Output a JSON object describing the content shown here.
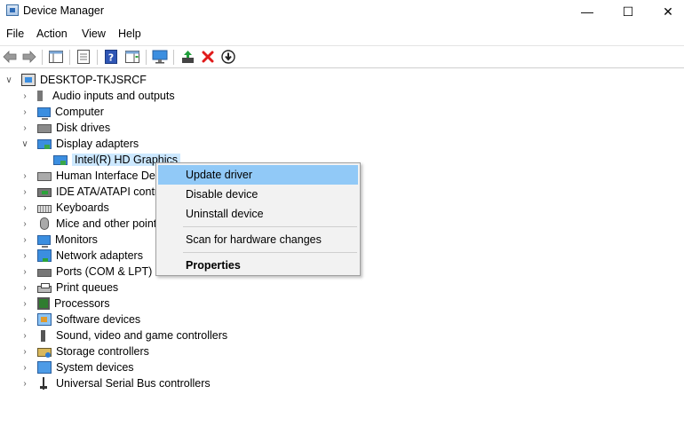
{
  "window": {
    "title": "Device Manager",
    "minimize": "—",
    "maximize": "☐",
    "close": "✕"
  },
  "menu": [
    "File",
    "Action",
    "View",
    "Help"
  ],
  "tree": {
    "root": "DESKTOP-TKJSRCF",
    "expanded_caret": "∨",
    "collapsed_caret": "›",
    "categories": [
      {
        "label": "Audio inputs and outputs",
        "icon": "speaker-icon"
      },
      {
        "label": "Computer",
        "icon": "monitor-icon"
      },
      {
        "label": "Disk drives",
        "icon": "disk-drive-icon"
      },
      {
        "label": "Display adapters",
        "icon": "display-adapter-icon",
        "expanded": true
      },
      {
        "label": "Intel(R) HD Graphics",
        "icon": "display-adapter-icon",
        "child": true,
        "selected": true
      },
      {
        "label": "Human Interface Dev",
        "icon": "hid-icon"
      },
      {
        "label": "IDE ATA/ATAPI contro",
        "icon": "ide-controller-icon"
      },
      {
        "label": "Keyboards",
        "icon": "keyboard-icon"
      },
      {
        "label": "Mice and other point",
        "icon": "mouse-icon"
      },
      {
        "label": "Monitors",
        "icon": "monitor-icon"
      },
      {
        "label": "Network adapters",
        "icon": "network-adapter-icon"
      },
      {
        "label": "Ports (COM & LPT)",
        "icon": "port-icon"
      },
      {
        "label": "Print queues",
        "icon": "printer-icon"
      },
      {
        "label": "Processors",
        "icon": "processor-icon"
      },
      {
        "label": "Software devices",
        "icon": "software-device-icon"
      },
      {
        "label": "Sound, video and game controllers",
        "icon": "sound-icon"
      },
      {
        "label": "Storage controllers",
        "icon": "storage-controller-icon"
      },
      {
        "label": "System devices",
        "icon": "system-device-icon"
      },
      {
        "label": "Universal Serial Bus controllers",
        "icon": "usb-icon"
      }
    ]
  },
  "context_menu": {
    "update_driver": "Update driver",
    "disable_device": "Disable device",
    "uninstall_device": "Uninstall device",
    "scan_hardware": "Scan for hardware changes",
    "properties": "Properties"
  },
  "colors": {
    "selection": "#cce8ff",
    "menu_highlight": "#91c9f7",
    "accent": "#2d6bb7",
    "remove_red": "#e01a1a",
    "enable_green": "#1f9e3a"
  }
}
